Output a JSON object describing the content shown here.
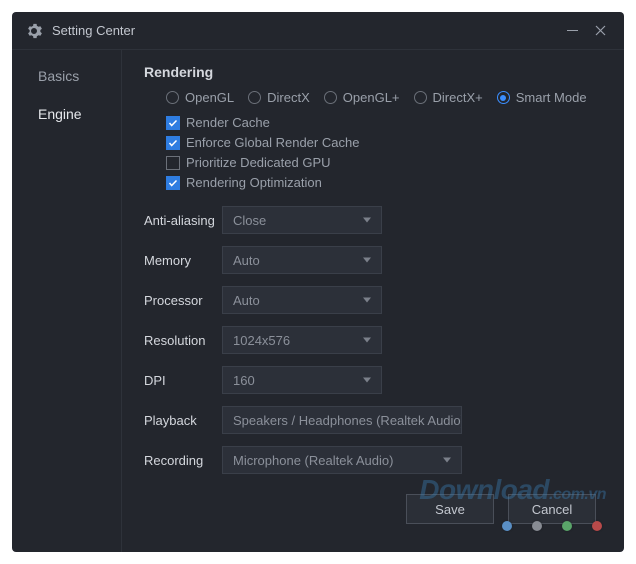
{
  "window": {
    "title": "Setting Center"
  },
  "sidebar": {
    "tabs": [
      {
        "label": "Basics",
        "active": false
      },
      {
        "label": "Engine",
        "active": true
      }
    ]
  },
  "rendering": {
    "title": "Rendering",
    "modes": [
      {
        "label": "OpenGL",
        "selected": false
      },
      {
        "label": "DirectX",
        "selected": false
      },
      {
        "label": "OpenGL+",
        "selected": false
      },
      {
        "label": "DirectX+",
        "selected": false
      },
      {
        "label": "Smart Mode",
        "selected": true
      }
    ],
    "checks": [
      {
        "label": "Render Cache",
        "checked": true
      },
      {
        "label": "Enforce Global Render Cache",
        "checked": true
      },
      {
        "label": "Prioritize Dedicated GPU",
        "checked": false
      },
      {
        "label": "Rendering Optimization",
        "checked": true
      }
    ]
  },
  "settings": {
    "antialias": {
      "label": "Anti-aliasing",
      "value": "Close"
    },
    "memory": {
      "label": "Memory",
      "value": "Auto"
    },
    "processor": {
      "label": "Processor",
      "value": "Auto"
    },
    "resolution": {
      "label": "Resolution",
      "value": "1024x576"
    },
    "dpi": {
      "label": "DPI",
      "value": "160"
    },
    "playback": {
      "label": "Playback",
      "value": "Speakers / Headphones (Realtek Audio)"
    },
    "recording": {
      "label": "Recording",
      "value": "Microphone (Realtek Audio)"
    }
  },
  "buttons": {
    "save": "Save",
    "cancel": "Cancel"
  },
  "watermark": {
    "main": "Download",
    "sub": ".com.vn"
  }
}
